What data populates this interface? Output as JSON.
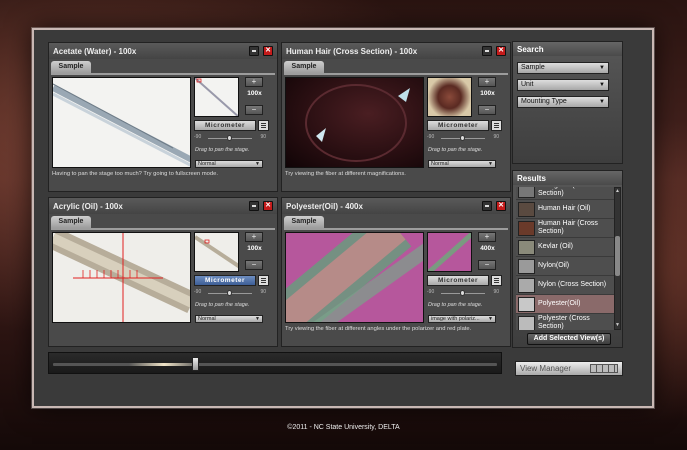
{
  "windows": [
    {
      "title": "Acetate (Water) - 100x",
      "tab": "Sample",
      "zoom": "100x",
      "micrometer": "Micrometer",
      "micro_active": false,
      "slider_min": "-90",
      "slider_max": "90",
      "drag_hint": "Drag to pan the stage.",
      "mode": "Normal",
      "caption": "Having to pan the stage too much? Try going to fullscreen mode."
    },
    {
      "title": "Human Hair (Cross Section) - 100x",
      "tab": "Sample",
      "zoom": "100x",
      "micrometer": "Micrometer",
      "micro_active": false,
      "slider_min": "-90",
      "slider_max": "90",
      "drag_hint": "Drag to pan the stage.",
      "mode": "Normal",
      "caption": "Try viewing the fiber at different magnifications."
    },
    {
      "title": "Acrylic (Oil) - 100x",
      "tab": "Sample",
      "zoom": "100x",
      "micrometer": "Micrometer",
      "micro_active": true,
      "slider_min": "-90",
      "slider_max": "90",
      "drag_hint": "Drag to pan the stage.",
      "mode": "Normal",
      "caption": ""
    },
    {
      "title": "Polyester(Oil) - 400x",
      "tab": "Sample",
      "zoom": "400x",
      "micrometer": "Micrometer",
      "micro_active": false,
      "slider_min": "-90",
      "slider_max": "90",
      "drag_hint": "Drag to pan the stage.",
      "mode": "image with polariz...",
      "caption": "Try viewing the fiber at different angles under the polarizer and red plate."
    }
  ],
  "search": {
    "title": "Search",
    "sample": "Sample",
    "unit": "Unit",
    "mounting": "Mounting Type"
  },
  "results": {
    "title": "Results",
    "items": [
      "Fiberglass (Cross Section)",
      "Human Hair (Oil)",
      "Human Hair (Cross Section)",
      "Kevlar (Oil)",
      "Nylon(Oil)",
      "Nylon (Cross Section)",
      "Polyester(Oil)",
      "Polyester (Cross Section)"
    ],
    "add_button": "Add Selected View(s)"
  },
  "view_manager": "View Manager",
  "copyright": "©2011 - NC State University, DELTA",
  "colors": {
    "close": "#c41a1a",
    "active_micro": "#3d5e96",
    "selected_row": "#8a6a6a"
  }
}
